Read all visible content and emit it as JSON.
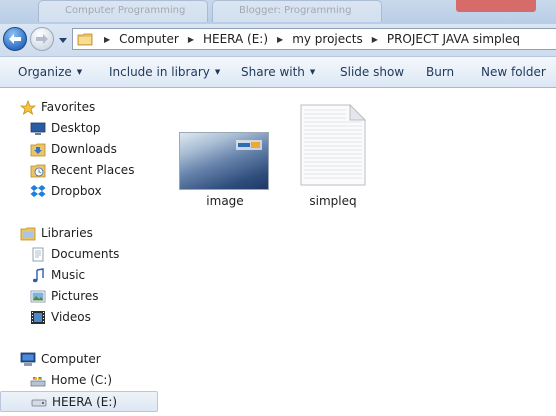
{
  "titlebar": {
    "tab1_label": "Computer Programming",
    "tab2_label": "Blogger: Programming"
  },
  "address": {
    "segments": [
      "Computer",
      "HEERA (E:)",
      "my projects",
      "PROJECT JAVA simpleq"
    ]
  },
  "commands": {
    "organize": "Organize",
    "include_in_library": "Include in library",
    "share_with": "Share with",
    "slide_show": "Slide show",
    "burn": "Burn",
    "new_folder": "New folder"
  },
  "nav": {
    "favorites": {
      "label": "Favorites",
      "icon": "star-icon",
      "items": [
        {
          "label": "Desktop",
          "icon": "desktop-icon"
        },
        {
          "label": "Downloads",
          "icon": "downloads-folder-icon"
        },
        {
          "label": "Recent Places",
          "icon": "recent-places-icon"
        },
        {
          "label": "Dropbox",
          "icon": "dropbox-icon"
        }
      ]
    },
    "libraries": {
      "label": "Libraries",
      "icon": "libraries-icon",
      "items": [
        {
          "label": "Documents",
          "icon": "documents-icon"
        },
        {
          "label": "Music",
          "icon": "music-icon"
        },
        {
          "label": "Pictures",
          "icon": "pictures-icon"
        },
        {
          "label": "Videos",
          "icon": "videos-icon"
        }
      ]
    },
    "computer": {
      "label": "Computer",
      "icon": "computer-icon",
      "items": [
        {
          "label": "Home (C:)",
          "icon": "drive-c-icon"
        },
        {
          "label": "HEERA (E:)",
          "icon": "usb-drive-icon",
          "selected": true
        }
      ]
    }
  },
  "files": [
    {
      "name": "image",
      "type": "image"
    },
    {
      "name": "simpleq",
      "type": "text-file"
    }
  ],
  "colors": {
    "selection_border": "#b8c7da",
    "command_text": "#1e395b",
    "window_chrome": "#cfdcee"
  }
}
